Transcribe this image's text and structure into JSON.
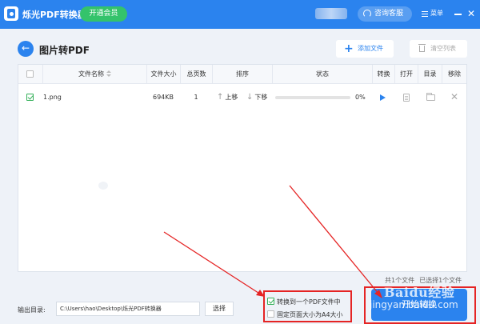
{
  "app": {
    "title": "烁光PDF转换器",
    "vip_label": "开通会员",
    "support_label": "咨询客服",
    "menu_label": "菜单",
    "close_glyph": "✕",
    "brand_color": "#2b83ee"
  },
  "header": {
    "back_glyph": "←",
    "title": "图片转PDF",
    "add_file_plus": "+",
    "add_file_label": "添加文件",
    "clear_label": "清空列表"
  },
  "table": {
    "columns": [
      "文件名称",
      "文件大小",
      "总页数",
      "排序",
      "状态",
      "转换",
      "打开",
      "目录",
      "移除"
    ],
    "rows": [
      {
        "checked": true,
        "name": "1.png",
        "size": "694KB",
        "pages": "1",
        "up_label": "上移",
        "down_label": "下移",
        "progress": 0,
        "progress_text": "0%"
      }
    ]
  },
  "summary": {
    "total": "共1个文件",
    "selected": "已选择1个文件"
  },
  "output": {
    "label": "输出目录:",
    "path": "C:\\Users\\hao\\Desktop\\烁光PDF转换器",
    "browse_label": "选择"
  },
  "options": [
    {
      "label": "转换到一个PDF文件中",
      "checked": true
    },
    {
      "label": "固定页面大小为A4大小",
      "checked": false
    }
  ],
  "start_label": "开始转换",
  "watermark": {
    "line1": "Baidu经验",
    "line2": "jingyan.baidu.com"
  }
}
